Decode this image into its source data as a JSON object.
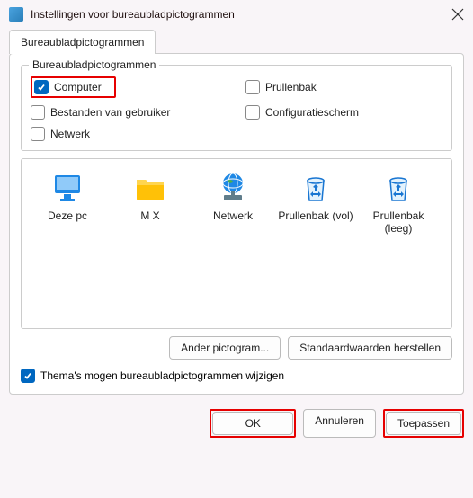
{
  "title": "Instellingen voor bureaubladpictogrammen",
  "tab": {
    "label": "Bureaubladpictogrammen"
  },
  "fieldset": {
    "legend": "Bureaubladpictogrammen"
  },
  "checks": {
    "computer": {
      "label": "Computer",
      "checked": true
    },
    "recyclebin": {
      "label": "Prullenbak",
      "checked": false
    },
    "userfiles": {
      "label": "Bestanden van gebruiker",
      "checked": false
    },
    "controlpanel": {
      "label": "Configuratiescherm",
      "checked": false
    },
    "network": {
      "label": "Netwerk",
      "checked": false
    }
  },
  "icons": {
    "thispc": {
      "label": "Deze pc"
    },
    "user": {
      "label": "M X"
    },
    "network": {
      "label": "Netwerk"
    },
    "binfull": {
      "label": "Prullenbak (vol)"
    },
    "binempty": {
      "label": "Prullenbak (leeg)"
    }
  },
  "buttons": {
    "changeicon": "Ander pictogram...",
    "restore": "Standaardwaarden herstellen",
    "ok": "OK",
    "cancel": "Annuleren",
    "apply": "Toepassen"
  },
  "theme_check": {
    "label": "Thema's mogen bureaubladpictogrammen wijzigen",
    "checked": true
  }
}
